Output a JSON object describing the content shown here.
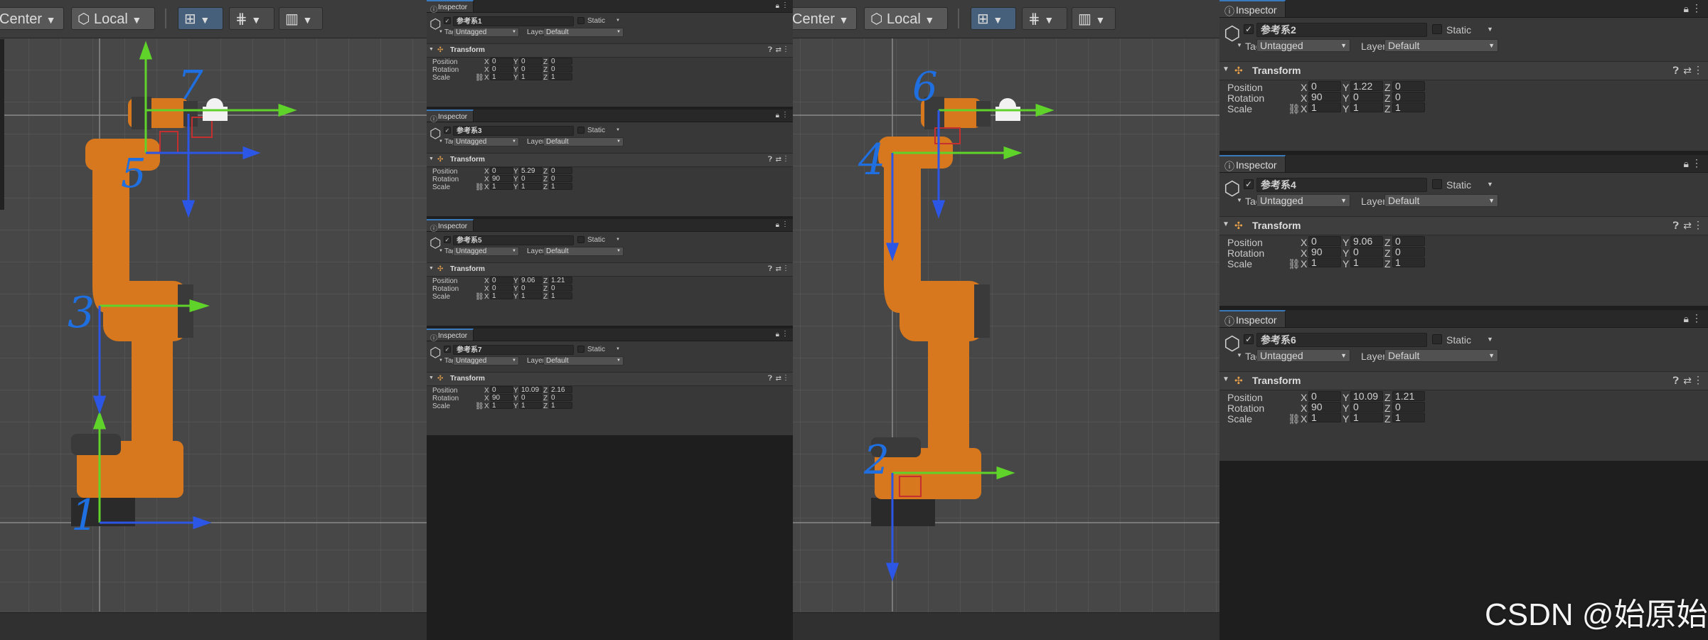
{
  "toolbar": {
    "pivot_mode": "Center",
    "pivot_rotation": "Local"
  },
  "scene_left": {
    "annotations": [
      "7",
      "5",
      "3",
      "1"
    ]
  },
  "scene_right": {
    "annotations": [
      "6",
      "4",
      "2"
    ]
  },
  "inspector_labels": {
    "tab_title": "Inspector",
    "static_label": "Static",
    "tag_label": "Tag",
    "layer_label": "Layer",
    "component_title": "Transform",
    "position_label": "Position",
    "rotation_label": "Rotation",
    "scale_label": "Scale",
    "axis_x": "X",
    "axis_y": "Y",
    "axis_z": "Z"
  },
  "inspectors_middle": [
    {
      "object_name": "参考系1",
      "tag": "Untagged",
      "layer": "Default",
      "position": [
        "0",
        "0",
        "0"
      ],
      "rotation": [
        "0",
        "0",
        "0"
      ],
      "scale": [
        "1",
        "1",
        "1"
      ]
    },
    {
      "object_name": "参考系3",
      "tag": "Untagged",
      "layer": "Default",
      "position": [
        "0",
        "5.29",
        "0"
      ],
      "rotation": [
        "90",
        "0",
        "0"
      ],
      "scale": [
        "1",
        "1",
        "1"
      ]
    },
    {
      "object_name": "参考系5",
      "tag": "Untagged",
      "layer": "Default",
      "position": [
        "0",
        "9.06",
        "1.21"
      ],
      "rotation": [
        "0",
        "0",
        "0"
      ],
      "scale": [
        "1",
        "1",
        "1"
      ]
    },
    {
      "object_name": "参考系7",
      "tag": "Untagged",
      "layer": "Default",
      "position": [
        "0",
        "10.09",
        "2.16"
      ],
      "rotation": [
        "90",
        "0",
        "0"
      ],
      "scale": [
        "1",
        "1",
        "1"
      ]
    }
  ],
  "inspectors_right": [
    {
      "object_name": "参考系2",
      "tag": "Untagged",
      "layer": "Default",
      "position": [
        "0",
        "1.22",
        "0"
      ],
      "rotation": [
        "90",
        "0",
        "0"
      ],
      "scale": [
        "1",
        "1",
        "1"
      ]
    },
    {
      "object_name": "参考系4",
      "tag": "Untagged",
      "layer": "Default",
      "position": [
        "0",
        "9.06",
        "0"
      ],
      "rotation": [
        "90",
        "0",
        "0"
      ],
      "scale": [
        "1",
        "1",
        "1"
      ]
    },
    {
      "object_name": "参考系6",
      "tag": "Untagged",
      "layer": "Default",
      "position": [
        "0",
        "10.09",
        "1.21"
      ],
      "rotation": [
        "90",
        "0",
        "0"
      ],
      "scale": [
        "1",
        "1",
        "1"
      ]
    }
  ],
  "watermark": "CSDN @始原始",
  "colors": {
    "robot_orange": "#d8781e",
    "robot_dark": "#3a3a3a",
    "gizmo_green": "#5fd32a",
    "gizmo_blue": "#2c57e6",
    "annotation_blue": "#1f6fe0",
    "accent_blue": "#3a79bb"
  }
}
